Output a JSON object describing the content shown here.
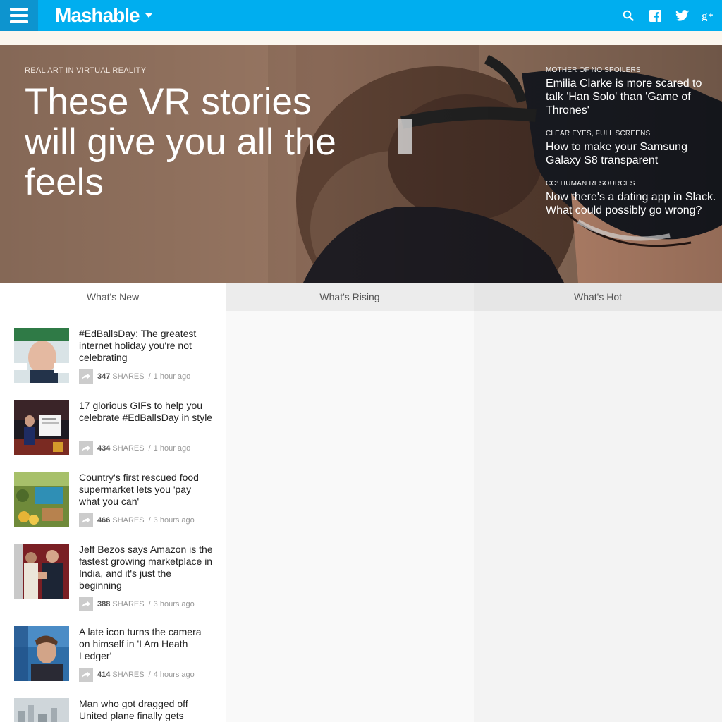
{
  "header": {
    "logo": "Mashable",
    "icons": [
      "search-icon",
      "facebook-icon",
      "twitter-icon",
      "google-plus-icon"
    ],
    "brand_color": "#00aeef"
  },
  "hero": {
    "kicker": "REAL ART IN VIRTUAL REALITY",
    "title": "These VR stories will give you all the feels",
    "side_stories": [
      {
        "kicker": "MOTHER OF NO SPOILERS",
        "title": "Emilia Clarke is more scared to talk 'Han Solo' than 'Game of Thrones'"
      },
      {
        "kicker": "CLEAR EYES, FULL SCREENS",
        "title": "How to make your Samsung Galaxy S8 transparent"
      },
      {
        "kicker": "CC: HUMAN RESOURCES",
        "title": "Now there's a dating app in Slack. What could possibly go wrong?"
      }
    ]
  },
  "columns": {
    "new": "What's New",
    "rising": "What's Rising",
    "hot": "What's Hot"
  },
  "stories": [
    {
      "title": "#EdBallsDay: The greatest internet holiday you're not celebrating",
      "shares": "347",
      "shares_label": "SHARES",
      "time": "1 hour ago"
    },
    {
      "title": "17 glorious GIFs to help you celebrate #EdBallsDay in style",
      "shares": "434",
      "shares_label": "SHARES",
      "time": "1 hour ago"
    },
    {
      "title": "Country's first rescued food supermarket lets you 'pay what you can'",
      "shares": "466",
      "shares_label": "SHARES",
      "time": "3 hours ago"
    },
    {
      "title": "Jeff Bezos says Amazon is the fastest growing marketplace in India, and it's just the beginning",
      "shares": "388",
      "shares_label": "SHARES",
      "time": "3 hours ago"
    },
    {
      "title": "A late icon turns the camera on himself in 'I Am Heath Ledger'",
      "shares": "414",
      "shares_label": "SHARES",
      "time": "4 hours ago"
    },
    {
      "title": "Man who got dragged off United plane finally gets"
    }
  ]
}
